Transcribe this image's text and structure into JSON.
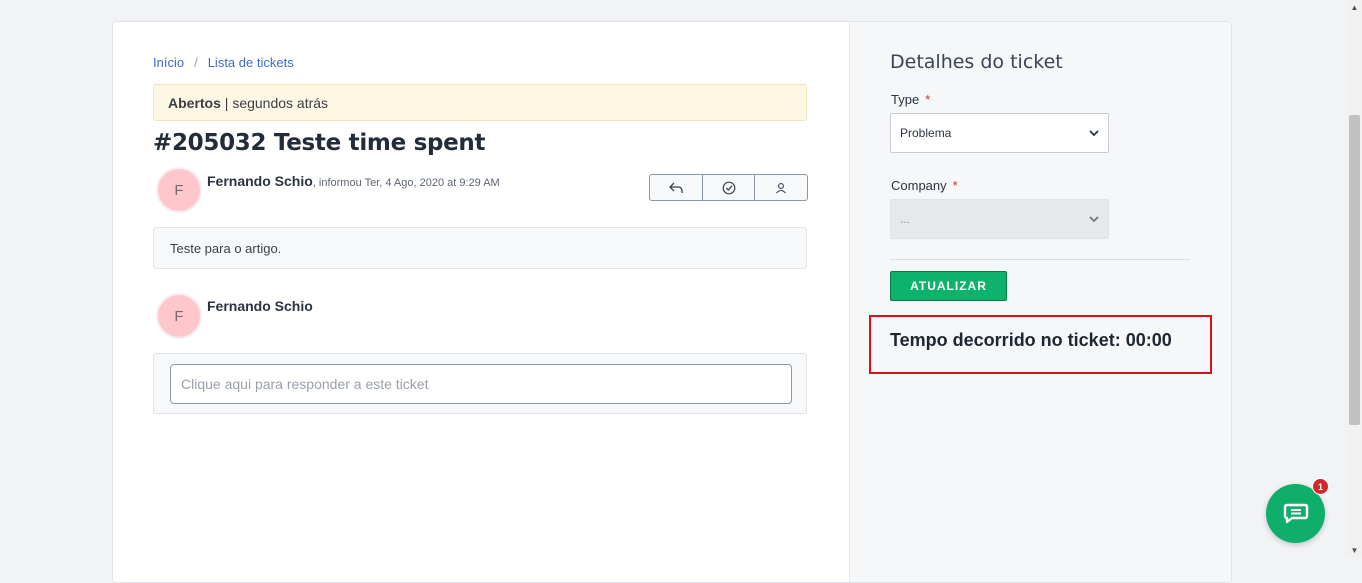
{
  "breadcrumb": {
    "home": "Início",
    "separator": "/",
    "current": "Lista de tickets"
  },
  "status": {
    "state": "Abertos",
    "separator": " | ",
    "time": "segundos atrás"
  },
  "ticket": {
    "title": "#205032 Teste time spent"
  },
  "message": {
    "avatar_letter": "F",
    "author": "Fernando Schio",
    "meta": ", informou Ter, 4 Ago, 2020 at 9:29 AM",
    "body": "Teste para o artigo."
  },
  "actions": {
    "reply_icon": "reply-icon",
    "resolve_icon": "check-circle-icon",
    "assign_icon": "user-icon"
  },
  "reply": {
    "avatar_letter": "F",
    "author": "Fernando Schio",
    "placeholder": "Clique aqui para responder a este ticket"
  },
  "sidebar": {
    "title": "Detalhes do ticket",
    "type_label": "Type",
    "type_value": "Problema",
    "company_label": "Company",
    "company_value": "...",
    "required_mark": "*",
    "update_button": "ATUALIZAR",
    "time_spent": "Tempo decorrido no ticket: 00:00"
  },
  "chat": {
    "badge_count": "1",
    "icon": "chat-icon"
  },
  "colors": {
    "accent_green": "#0db26b",
    "highlight_red": "#d8111d",
    "link_blue": "#3b6cc7"
  }
}
